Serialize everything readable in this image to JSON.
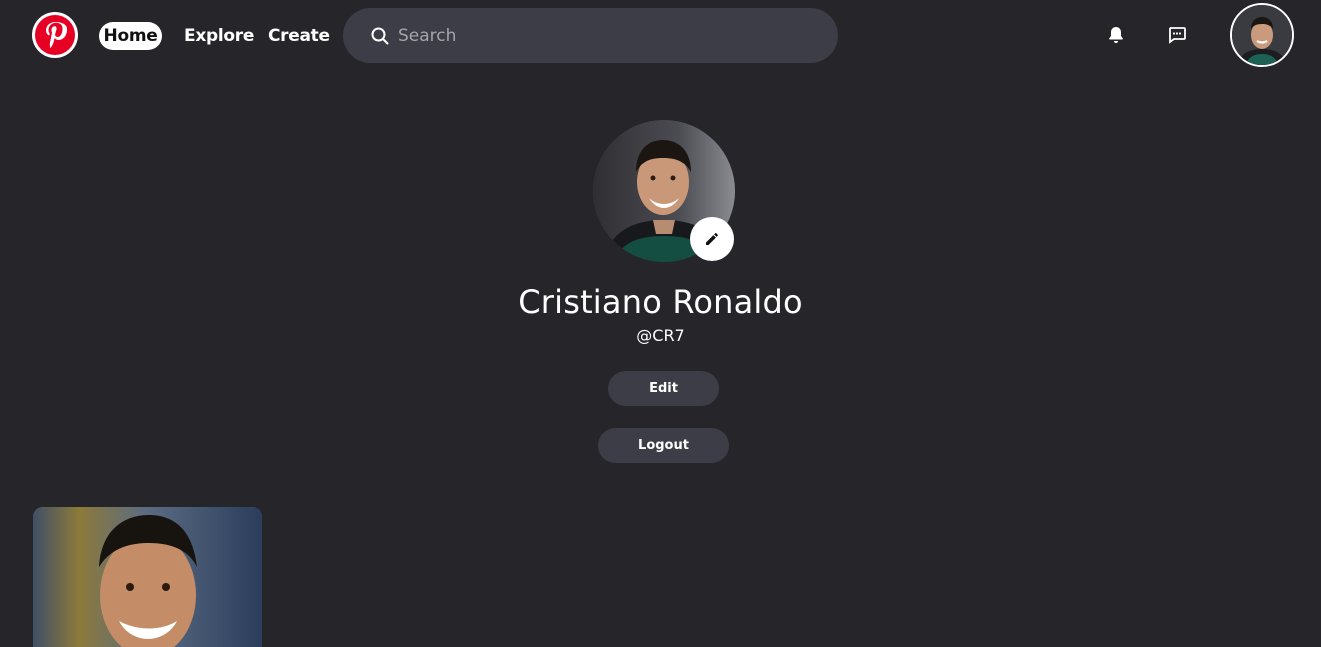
{
  "header": {
    "logo_icon": "pinterest-logo-icon",
    "nav": {
      "home": "Home",
      "explore": "Explore",
      "create": "Create"
    },
    "search": {
      "placeholder": "Search",
      "value": ""
    },
    "icons": [
      "bell-icon",
      "message-icon"
    ],
    "avatar_icon": "user-avatar"
  },
  "profile": {
    "name": "Cristiano Ronaldo",
    "handle": "@CR7",
    "edit_label": "Edit",
    "logout_label": "Logout"
  },
  "pins": [
    {
      "alt": ""
    }
  ],
  "colors": {
    "background": "#26252a",
    "surface": "#3d3d47",
    "brand": "#e60023",
    "text": "#ffffff"
  }
}
